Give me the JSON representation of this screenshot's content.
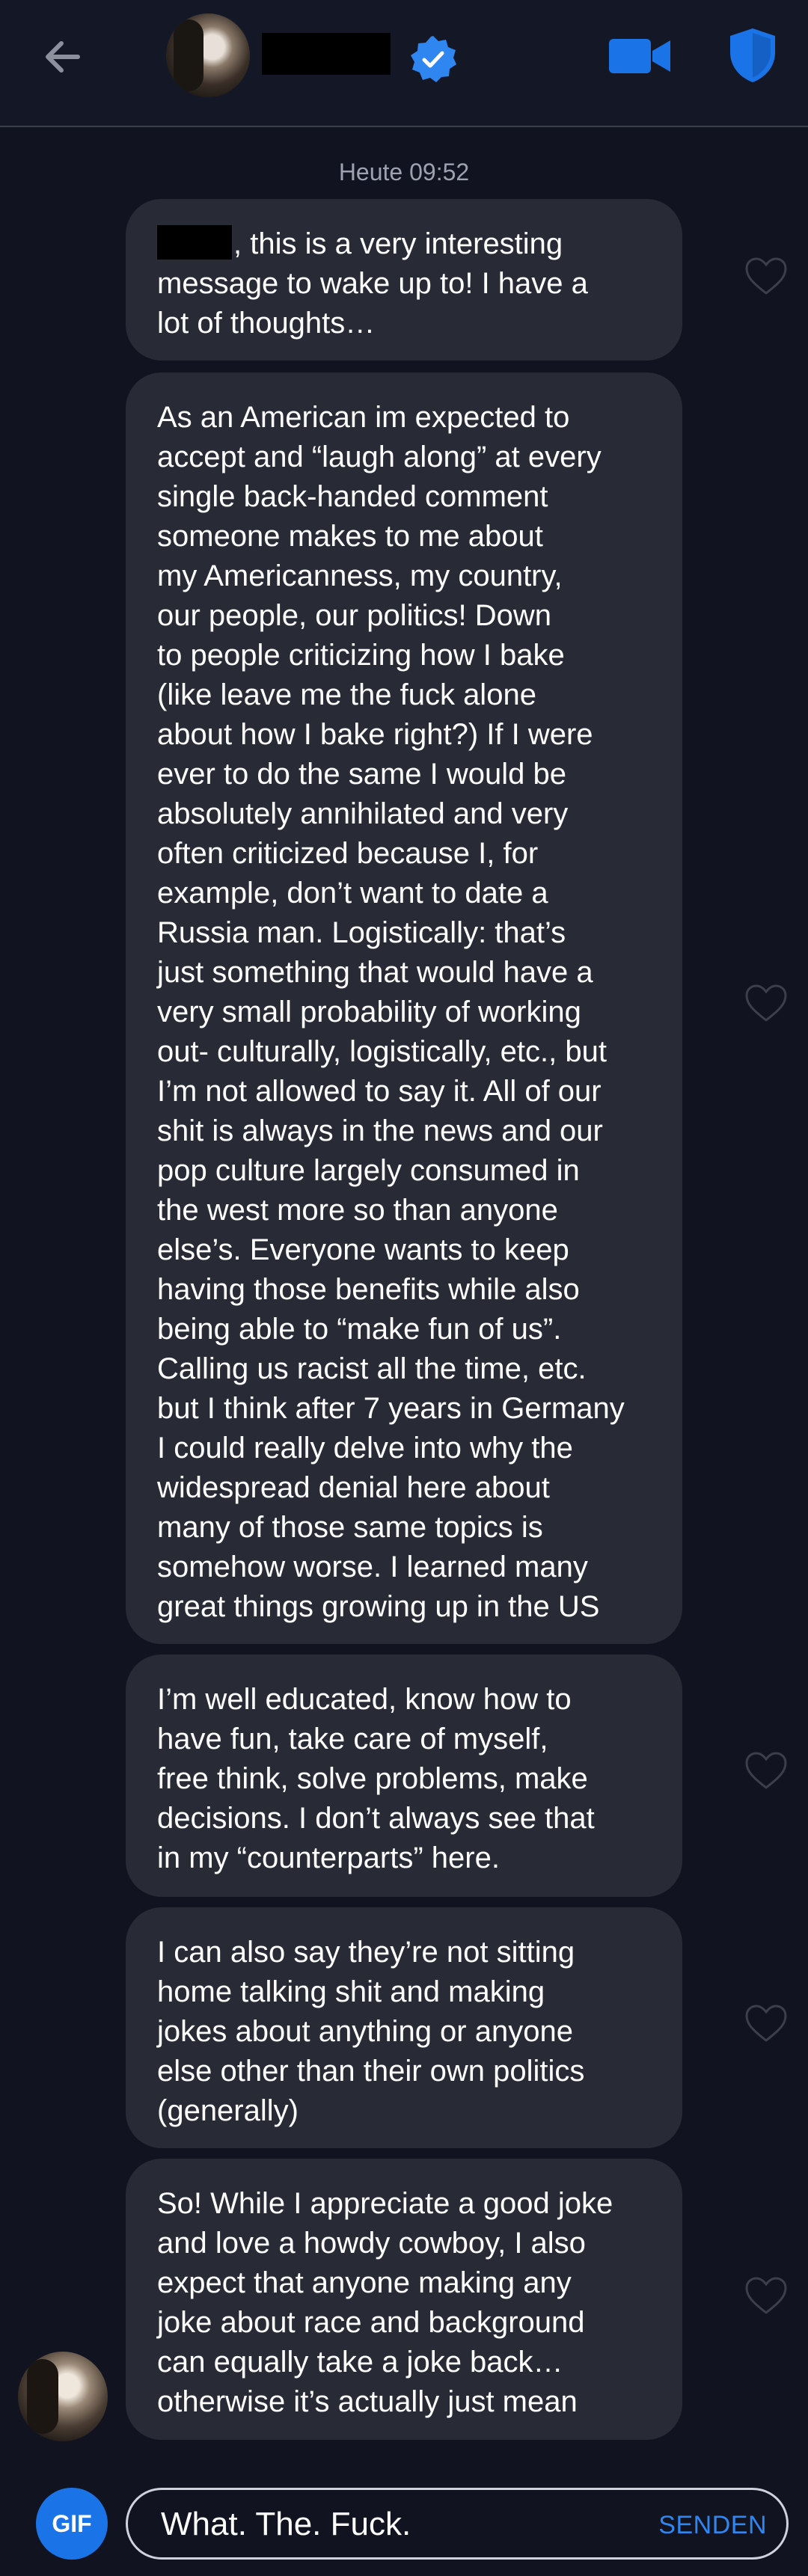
{
  "header": {
    "back_icon": "arrow-left-icon",
    "verified_icon": "verified-check-icon",
    "video_icon": "video-camera-icon",
    "shield_icon": "shield-icon",
    "accent_color": "#1b73e8"
  },
  "chat": {
    "timestamp": "Heute 09:52",
    "messages": [
      {
        "text": ", this is a very interesting\nmessage to wake up to! I have a\nlot of thoughts…"
      },
      {
        "text": "As an American im expected to\naccept and “laugh along” at every\nsingle back-handed comment\nsomeone makes to me about\nmy Americanness, my country,\nour people, our politics! Down\nto people criticizing how I bake\n(like leave me the fuck alone\nabout how I bake right?) If I were\never to do the same I would be\nabsolutely annihilated and very\noften criticized because I, for\nexample, don’t want to date a\nRussia man. Logistically: that’s\njust something that would have a\nvery small probability of working\nout- culturally, logistically, etc., but\nI’m not allowed to say it. All of our\nshit is always in the news and our\npop culture largely consumed in\nthe west more so than anyone\nelse’s. Everyone wants to keep\nhaving those benefits while also\nbeing able to “make fun of us”.\nCalling us racist all the time, etc.\nbut I think after 7 years in Germany\nI could really delve into why the\nwidespread denial here about\nmany of those same topics is\nsomehow worse. I learned many\ngreat things growing up in the US"
      },
      {
        "text": "I’m well educated, know how to\nhave fun, take care of myself,\nfree think, solve problems, make\ndecisions. I don’t always see that\nin my “counterparts” here."
      },
      {
        "text": "I can also say they’re not sitting\nhome talking shit and making\njokes about anything or anyone\nelse other than their own politics\n(generally)"
      },
      {
        "text": "So! While I appreciate a good joke\nand love a howdy cowboy, I also\nexpect that anyone making any\njoke about race and background\ncan equally take a joke back…\notherwise it’s actually just mean"
      }
    ],
    "like_icon": "heart-outline-icon"
  },
  "composer": {
    "gif_label": "GIF",
    "input_value": "What. The. Fuck.",
    "send_label": "SENDEN"
  }
}
